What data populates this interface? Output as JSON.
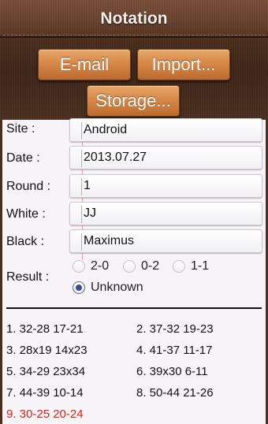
{
  "header": {
    "title": "Notation"
  },
  "toolbar": {
    "email_label": "E-mail",
    "import_label": "Import...",
    "storage_label": "Storage..."
  },
  "fields": [
    {
      "label": "Site :",
      "value": "Android"
    },
    {
      "label": "Date :",
      "value": "2013.07.27"
    },
    {
      "label": "Round :",
      "value": "1"
    },
    {
      "label": "White :",
      "value": "JJ"
    },
    {
      "label": "Black :",
      "value": "Maximus"
    }
  ],
  "result": {
    "label": "Result :",
    "options": [
      "2-0",
      "0-2",
      "1-1",
      "Unknown"
    ],
    "selected": "Unknown"
  },
  "moves": [
    "1. 32-28 17-21",
    "2. 37-32 19-23",
    "3. 28x19 14x23",
    "4. 41-37 11-17",
    "5. 34-29 23x34",
    "6. 39x30 6-11",
    "7. 44-39 10-14",
    "8. 50-44 21-26",
    "9. 30-25 20-24"
  ],
  "current_move_color": "#e0201c"
}
